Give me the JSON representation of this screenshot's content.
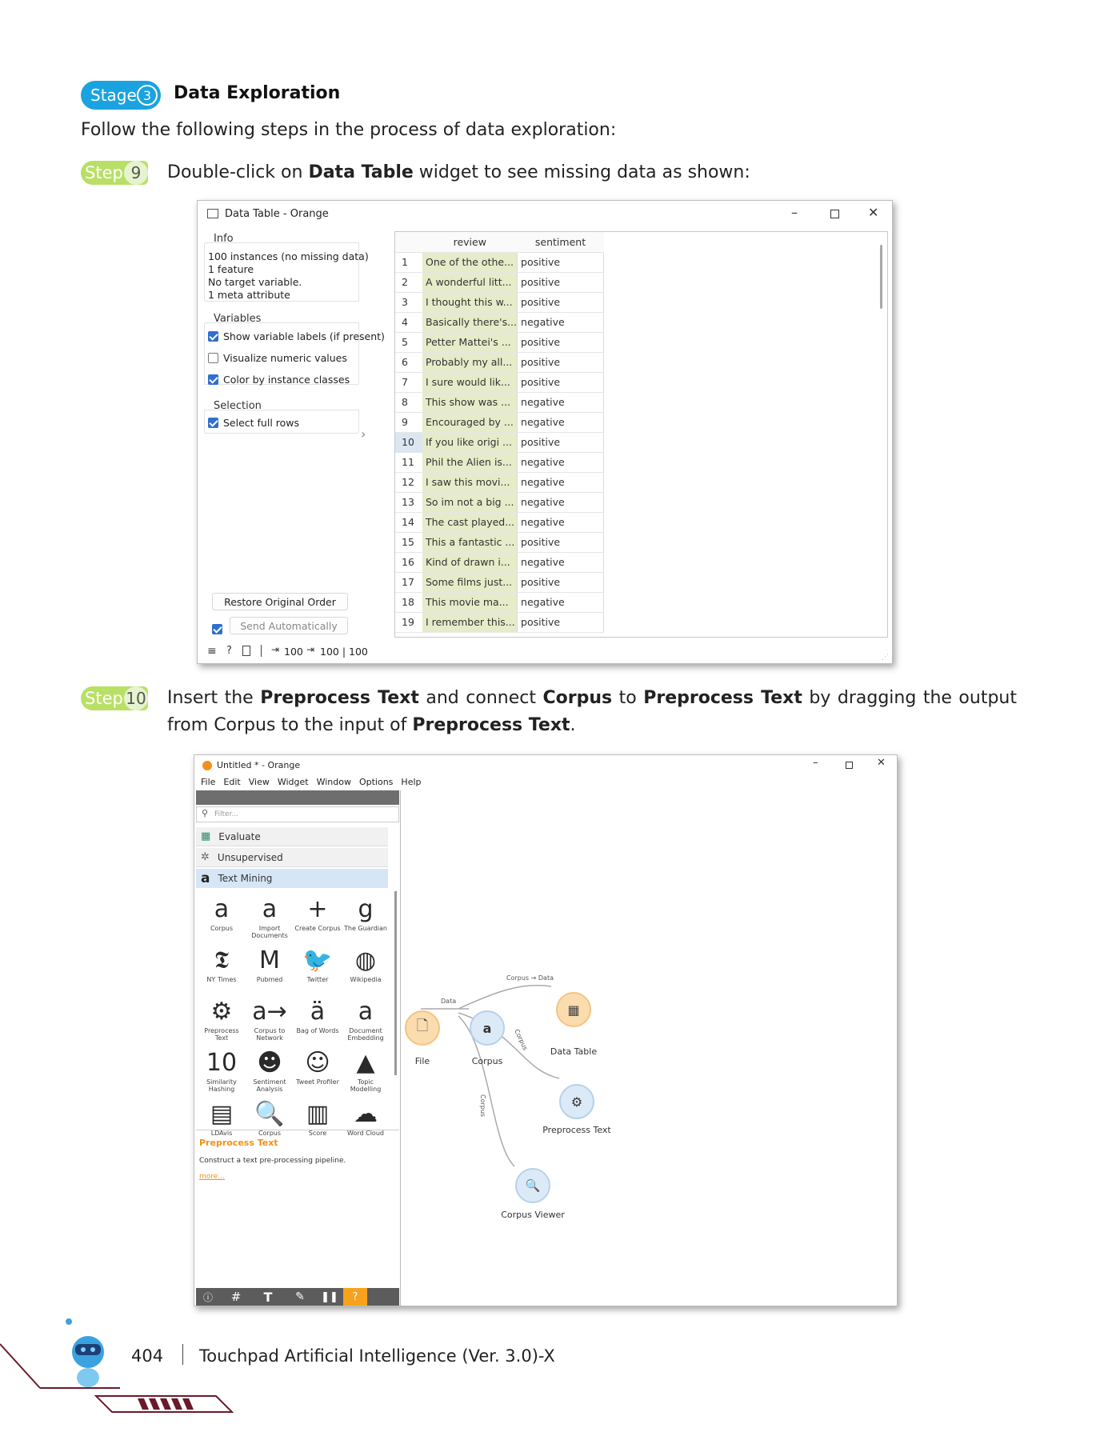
{
  "stage": {
    "label": "Stage",
    "number": "3",
    "title": "Data Exploration"
  },
  "intro": "Follow the following steps in the process of data exploration:",
  "step9": {
    "label": "Step",
    "number": "9",
    "text_a": "Double-click on ",
    "bold_a": "Data Table",
    "text_b": " widget to see missing data as shown:"
  },
  "data_table_window": {
    "title": "Data Table - Orange",
    "info_label": "Info",
    "info_lines": [
      "100 instances (no missing data)",
      "1 feature",
      "No target variable.",
      "1 meta attribute"
    ],
    "variables_label": "Variables",
    "checkboxes": [
      {
        "label": "Show variable labels (if present)",
        "checked": true
      },
      {
        "label": "Visualize numeric values",
        "checked": false
      },
      {
        "label": "Color by instance classes",
        "checked": true
      }
    ],
    "selection_label": "Selection",
    "select_full_rows": "Select full rows",
    "restore_button": "Restore Original Order",
    "send_auto": "Send Automatically",
    "status_in": "100",
    "status_out": "100 | 100",
    "columns": [
      "review",
      "sentiment"
    ],
    "rows": [
      [
        "1",
        "One of the othe...",
        "positive"
      ],
      [
        "2",
        "A wonderful litt...",
        "positive"
      ],
      [
        "3",
        "I thought this w...",
        "positive"
      ],
      [
        "4",
        "Basically there's...",
        "negative"
      ],
      [
        "5",
        "Petter Mattei's ...",
        "positive"
      ],
      [
        "6",
        "Probably my all...",
        "positive"
      ],
      [
        "7",
        "I sure would lik...",
        "positive"
      ],
      [
        "8",
        "This show was ...",
        "negative"
      ],
      [
        "9",
        "Encouraged by ...",
        "negative"
      ],
      [
        "10",
        "If you like origi ...",
        "positive"
      ],
      [
        "11",
        "Phil the Alien is...",
        "negative"
      ],
      [
        "12",
        "I saw this movi...",
        "negative"
      ],
      [
        "13",
        "So im not a big ...",
        "negative"
      ],
      [
        "14",
        "The cast played...",
        "negative"
      ],
      [
        "15",
        "This a fantastic ...",
        "positive"
      ],
      [
        "16",
        "Kind of drawn i...",
        "negative"
      ],
      [
        "17",
        "Some films just...",
        "positive"
      ],
      [
        "18",
        "This movie ma...",
        "negative"
      ],
      [
        "19",
        "I remember this...",
        "positive"
      ]
    ]
  },
  "step10": {
    "label": "Step",
    "number": "10",
    "t1": "Insert the ",
    "b1": "Preprocess Text",
    "t2": " and connect ",
    "b2": "Corpus",
    "t3": " to ",
    "b3": "Preprocess Text",
    "t4": " by dragging the output from Corpus to the input of ",
    "b4": "Preprocess Text",
    "t5": "."
  },
  "orange_window": {
    "title": "Untitled * - Orange",
    "menu": [
      "File",
      "Edit",
      "View",
      "Widget",
      "Window",
      "Options",
      "Help"
    ],
    "filter_placeholder": "Filter...",
    "categories": [
      "Evaluate",
      "Unsupervised",
      "Text Mining"
    ],
    "widgets": [
      {
        "name": "Corpus",
        "icon": "a"
      },
      {
        "name": "Import Documents",
        "icon": "a"
      },
      {
        "name": "Create Corpus",
        "icon": "+"
      },
      {
        "name": "The Guardian",
        "icon": "g"
      },
      {
        "name": "NY Times",
        "icon": "𝕿"
      },
      {
        "name": "Pubmed",
        "icon": "M"
      },
      {
        "name": "Twitter",
        "icon": "🐦"
      },
      {
        "name": "Wikipedia",
        "icon": "◍"
      },
      {
        "name": "Preprocess Text",
        "icon": "⚙"
      },
      {
        "name": "Corpus to Network",
        "icon": "a→"
      },
      {
        "name": "Bag of Words",
        "icon": "ä"
      },
      {
        "name": "Document Embedding",
        "icon": "a"
      },
      {
        "name": "Similarity Hashing",
        "icon": "10"
      },
      {
        "name": "Sentiment Analysis",
        "icon": "☻"
      },
      {
        "name": "Tweet Profiler",
        "icon": "☺"
      },
      {
        "name": "Topic Modelling",
        "icon": "▲"
      },
      {
        "name": "LDAvis",
        "icon": "▤"
      },
      {
        "name": "Corpus",
        "icon": "🔍"
      },
      {
        "name": "Score",
        "icon": "▥"
      },
      {
        "name": "Word Cloud",
        "icon": "☁"
      }
    ],
    "help_title": "Preprocess Text",
    "help_desc": "Construct a text pre-processing pipeline.",
    "help_more": "more...",
    "nodes": {
      "file": "File",
      "corpus": "Corpus",
      "data_table": "Data Table",
      "preprocess": "Preprocess Text",
      "corpus_viewer": "Corpus Viewer"
    },
    "links": {
      "file_corpus": "Data",
      "corpus_table": "Corpus → Data",
      "corpus_pre": "Corpus",
      "corpus_viewer": "Corpus"
    }
  },
  "footer": {
    "page": "404",
    "title": "Touchpad Artificial Intelligence (Ver. 3.0)-X"
  },
  "colors": {
    "stage": "#1aa3e0",
    "step": "#b8e066",
    "orange": "#f7a21d",
    "review_col": "#e6ecc9"
  }
}
